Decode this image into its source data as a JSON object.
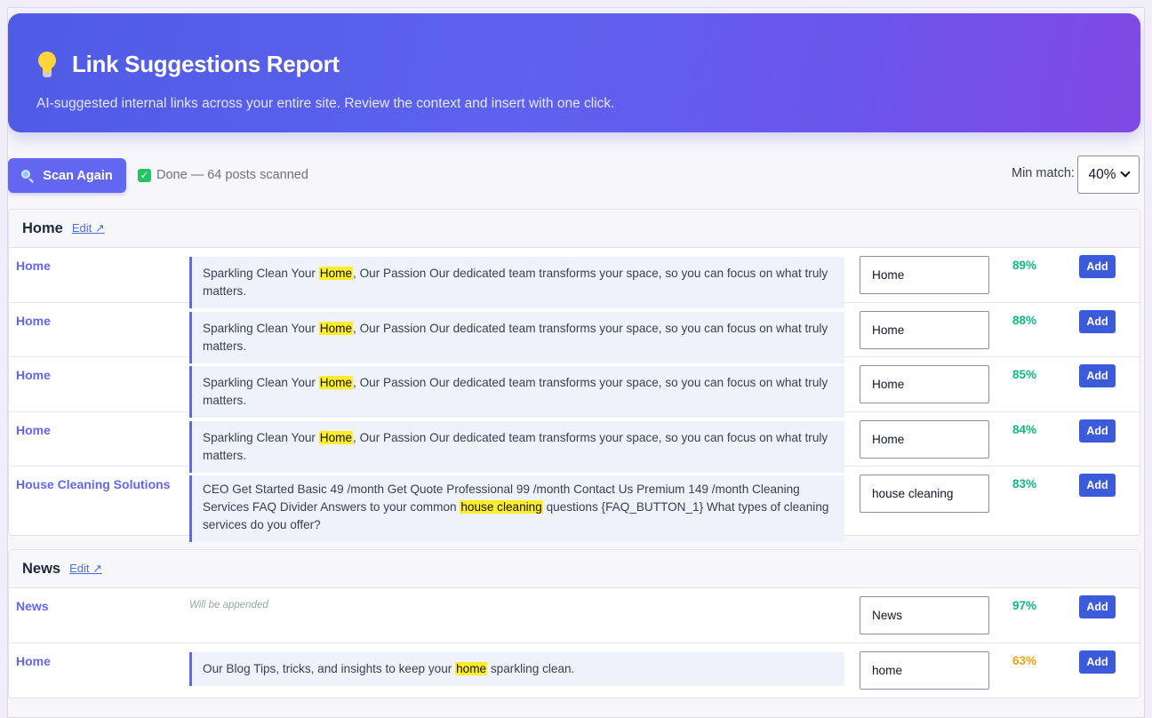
{
  "header": {
    "title": "Link Suggestions Report",
    "subtitle": "AI-suggested internal links across your entire site. Review the context and insert with one click."
  },
  "toolbar": {
    "scan_label": "Scan Again",
    "status": "Done — 64 posts scanned",
    "min_match_label": "Min match:",
    "min_match_value": "40%"
  },
  "colors": {
    "accent": "#6366f1",
    "add_button": "#3b5bdb",
    "high_score": "#10b981",
    "mid_score": "#f59e0b",
    "highlight": "#ffee29"
  },
  "groups": [
    {
      "title": "Home",
      "edit_label": "Edit ↗",
      "rows": [
        {
          "target": "Home",
          "context_pre": "Sparkling Clean Your ",
          "context_match": "Home",
          "context_post": ", Our Passion Our dedicated team transforms your space, so you can focus on what truly matters.",
          "anchor": "Home",
          "score": "89%",
          "add_label": "Add"
        },
        {
          "target": "Home",
          "context_pre": "Sparkling Clean Your ",
          "context_match": "Home",
          "context_post": ", Our Passion Our dedicated team transforms your space, so you can focus on what truly matters.",
          "anchor": "Home",
          "score": "88%",
          "add_label": "Add"
        },
        {
          "target": "Home",
          "context_pre": "Sparkling Clean Your ",
          "context_match": "Home",
          "context_post": ", Our Passion Our dedicated team transforms your space, so you can focus on what truly matters.",
          "anchor": "Home",
          "score": "85%",
          "add_label": "Add"
        },
        {
          "target": "Home",
          "context_pre": "Sparkling Clean Your ",
          "context_match": "Home",
          "context_post": ", Our Passion Our dedicated team transforms your space, so you can focus on what truly matters.",
          "anchor": "Home",
          "score": "84%",
          "add_label": "Add"
        },
        {
          "target": "House Cleaning Solutions",
          "context_pre": "CEO Get Started Basic 49 /month Get Quote Professional 99 /month Contact Us Premium 149 /month Cleaning Services FAQ Divider Answers to your common ",
          "context_match": "house cleaning",
          "context_post": " questions {FAQ_BUTTON_1} What types of cleaning services do you offer?",
          "anchor": "house cleaning",
          "score": "83%",
          "add_label": "Add"
        }
      ]
    },
    {
      "title": "News",
      "edit_label": "Edit ↗",
      "rows": [
        {
          "target": "News",
          "appended_note": "Will be appended",
          "anchor": "News",
          "score": "97%",
          "add_label": "Add"
        },
        {
          "target": "Home",
          "context_pre": "Our Blog Tips, tricks, and insights to keep your ",
          "context_match": "home",
          "context_post": " sparkling clean.",
          "anchor": "home",
          "score": "63%",
          "add_label": "Add"
        }
      ]
    }
  ]
}
